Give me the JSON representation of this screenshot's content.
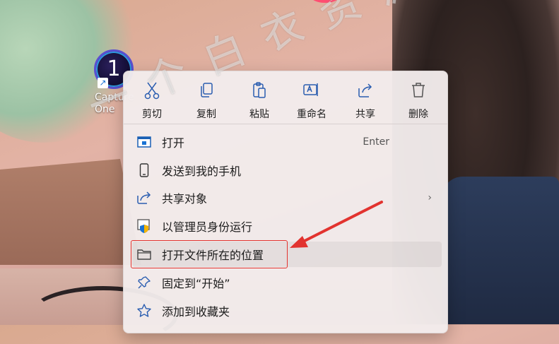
{
  "desktop": {
    "icon_label": "Capture One",
    "icon_glyph": "1"
  },
  "quick_actions": [
    {
      "label": "剪切",
      "icon": "scissors-icon"
    },
    {
      "label": "复制",
      "icon": "copy-icon"
    },
    {
      "label": "粘贴",
      "icon": "paste-icon"
    },
    {
      "label": "重命名",
      "icon": "rename-icon"
    },
    {
      "label": "共享",
      "icon": "share-icon"
    },
    {
      "label": "删除",
      "icon": "trash-icon"
    }
  ],
  "menu_items": [
    {
      "label": "打开",
      "shortcut": "Enter",
      "icon": "window-icon"
    },
    {
      "label": "发送到我的手机",
      "icon": "phone-icon"
    },
    {
      "label": "共享对象",
      "icon": "share-icon",
      "has_submenu": true
    },
    {
      "label": "以管理员身份运行",
      "icon": "admin-shield-icon"
    },
    {
      "label": "打开文件所在的位置",
      "icon": "folder-icon",
      "highlighted": true
    },
    {
      "label": "固定到“开始”",
      "icon": "pin-icon"
    },
    {
      "label": "添加到收藏夹",
      "icon": "star-icon"
    }
  ],
  "submenu_chevron": "›",
  "watermark": "一个白衣资源网",
  "colors": {
    "annotation": "#e2332f",
    "accent": "#1a73d4"
  }
}
